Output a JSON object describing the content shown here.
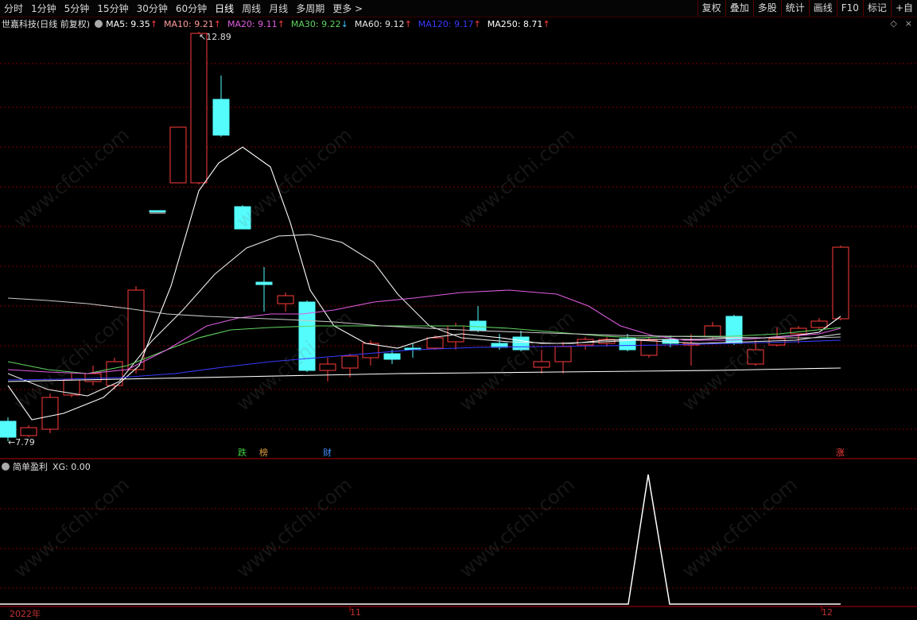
{
  "toolbar": {
    "periods": [
      {
        "label": "分时"
      },
      {
        "label": "1分钟"
      },
      {
        "label": "5分钟"
      },
      {
        "label": "15分钟"
      },
      {
        "label": "30分钟"
      },
      {
        "label": "60分钟"
      },
      {
        "label": "日线",
        "active": true
      },
      {
        "label": "周线"
      },
      {
        "label": "月线"
      },
      {
        "label": "多周期"
      },
      {
        "label": "更多 >"
      }
    ],
    "right_buttons": [
      {
        "label": "复权"
      },
      {
        "label": "叠加"
      },
      {
        "label": "多股"
      },
      {
        "label": "统计"
      },
      {
        "label": "画线"
      },
      {
        "label": "F10"
      },
      {
        "label": "标记"
      },
      {
        "label": "+自"
      }
    ]
  },
  "legend": {
    "stock": "世嘉科技(日线 前复权)",
    "items": [
      {
        "label": "MA5: 9.35",
        "arrow": "↑",
        "color": "#ffffff"
      },
      {
        "label": "MA10: 9.21",
        "arrow": "↑",
        "color": "#ff9b9b"
      },
      {
        "label": "MA20: 9.11",
        "arrow": "↑",
        "color": "#e05ce0"
      },
      {
        "label": "MA30: 9.22",
        "arrow": "↓",
        "color": "#5fd35f"
      },
      {
        "label": "MA60: 9.12",
        "arrow": "↑",
        "color": "#e8e8e8"
      },
      {
        "label": "MA120: 9.17",
        "arrow": "↑",
        "color": "#3a3aff"
      },
      {
        "label": "MA250: 8.71",
        "arrow": "↑",
        "color": "#ffffff"
      }
    ]
  },
  "top_right_icons": [
    "diamond-icon",
    "close-icon"
  ],
  "price_labels": {
    "high": "12.89",
    "low": "7.79"
  },
  "badges": [
    {
      "label": "跌",
      "color": "#40d040"
    },
    {
      "label": "榜",
      "color": "#e0a040"
    },
    {
      "label": "财",
      "color": "#4090ff"
    },
    {
      "label": "涨",
      "color": "#ff4040"
    }
  ],
  "indicator": {
    "name": "简单盈利",
    "value_label": "XG: 0.00"
  },
  "x_axis": [
    "2022年",
    "11",
    "12"
  ],
  "watermark": "www.cfchi.com",
  "colors": {
    "up": "#ff3c3c",
    "down": "#54fcfc",
    "grid": "#7a0000"
  }
}
